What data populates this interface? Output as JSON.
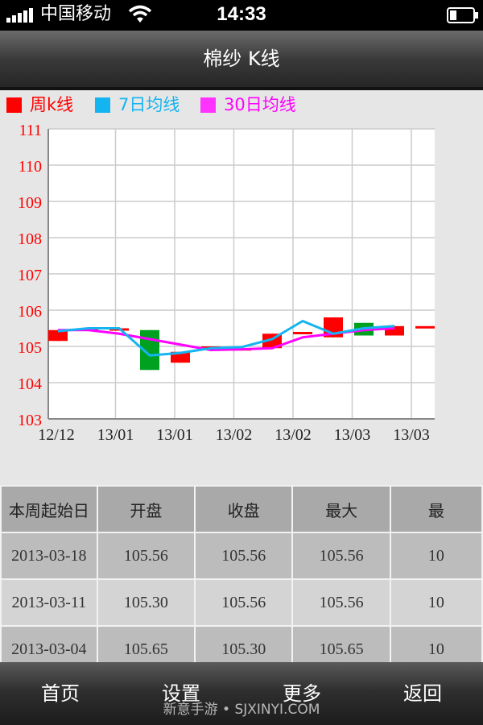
{
  "status_bar": {
    "carrier": "中国移动",
    "time": "14:33",
    "icons": [
      "signal-icon",
      "wifi-icon",
      "battery-icon"
    ]
  },
  "nav": {
    "title": "棉纱 K线"
  },
  "chart_data": {
    "type": "candlestick",
    "legend": [
      {
        "name": "周k线",
        "color": "#ff0000"
      },
      {
        "name": "7日均线",
        "color": "#14b4f0"
      },
      {
        "name": "30日均线",
        "color": "#ff00ff"
      }
    ],
    "x_tick_labels": [
      "12/12",
      "13/01",
      "13/01",
      "13/02",
      "13/02",
      "13/03",
      "13/03"
    ],
    "y_ticks": [
      103,
      104,
      105,
      106,
      107,
      108,
      109,
      110,
      111
    ],
    "ylim": [
      103,
      111
    ],
    "grid": true,
    "up_color": "#ff0000",
    "down_color": "#00a020",
    "candles": [
      {
        "open": 105.15,
        "close": 105.45,
        "high": 105.45,
        "low": 105.15
      },
      {
        "open": 105.5,
        "close": 105.5,
        "high": 105.5,
        "low": 105.5
      },
      {
        "open": 105.5,
        "close": 105.5,
        "high": 105.5,
        "low": 105.5
      },
      {
        "open": 105.45,
        "close": 104.35,
        "high": 105.45,
        "low": 104.35
      },
      {
        "open": 104.55,
        "close": 104.85,
        "high": 104.85,
        "low": 104.55
      },
      {
        "open": 105.0,
        "close": 105.0,
        "high": 105.0,
        "low": 105.0
      },
      {
        "open": 104.95,
        "close": 104.95,
        "high": 104.95,
        "low": 104.95
      },
      {
        "open": 104.95,
        "close": 105.35,
        "high": 105.35,
        "low": 104.95
      },
      {
        "open": 105.4,
        "close": 105.4,
        "high": 105.4,
        "low": 105.4
      },
      {
        "open": 105.25,
        "close": 105.8,
        "high": 105.8,
        "low": 105.25
      },
      {
        "open": 105.65,
        "close": 105.3,
        "high": 105.65,
        "low": 105.3
      },
      {
        "open": 105.3,
        "close": 105.56,
        "high": 105.56,
        "low": 105.3
      },
      {
        "open": 105.56,
        "close": 105.56,
        "high": 105.56,
        "low": 105.56
      }
    ],
    "ma7": [
      105.42,
      105.5,
      105.5,
      104.75,
      104.82,
      104.95,
      104.98,
      105.2,
      105.7,
      105.35,
      105.5,
      105.56
    ],
    "ma30": [
      105.45,
      105.45,
      105.35,
      105.2,
      105.05,
      104.9,
      104.92,
      104.95,
      105.25,
      105.35,
      105.45,
      105.5
    ]
  },
  "table": {
    "headers": [
      "本周起始日",
      "开盘",
      "收盘",
      "最大",
      "最"
    ],
    "rows": [
      [
        "2013-03-18",
        "105.56",
        "105.56",
        "105.56",
        "10"
      ],
      [
        "2013-03-11",
        "105.30",
        "105.56",
        "105.56",
        "10"
      ],
      [
        "2013-03-04",
        "105.65",
        "105.30",
        "105.65",
        "10"
      ]
    ]
  },
  "tabbar": {
    "items": [
      "首页",
      "设置",
      "更多",
      "返回"
    ]
  },
  "watermark": "新意手游 • SJXINYI.COM"
}
